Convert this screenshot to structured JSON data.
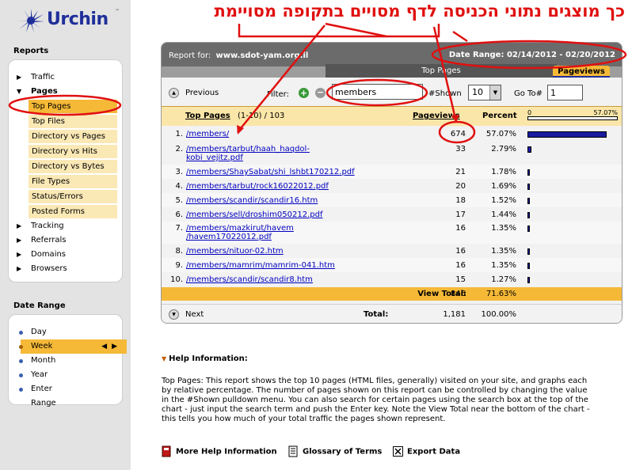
{
  "annotation": {
    "title": "כך מוצגים נתוני הכניסה לדף מסויים בתקופה מסויימת"
  },
  "brand": {
    "name": "Urchin",
    "mark": "™"
  },
  "sidebar": {
    "reports_title": "Reports",
    "items": [
      {
        "label": "Traffic",
        "icon": "triangle-right-icon"
      },
      {
        "label": "Pages",
        "icon": "triangle-down-icon",
        "expanded": true
      },
      {
        "label": "Tracking",
        "icon": "triangle-right-icon"
      },
      {
        "label": "Referrals",
        "icon": "triangle-right-icon"
      },
      {
        "label": "Domains",
        "icon": "triangle-right-icon"
      },
      {
        "label": "Browsers",
        "icon": "triangle-right-icon"
      }
    ],
    "pages_sub": [
      {
        "label": "Top Pages",
        "active": true
      },
      {
        "label": "Top Files"
      },
      {
        "label": "Directory vs Pages"
      },
      {
        "label": "Directory vs Hits"
      },
      {
        "label": "Directory vs Bytes"
      },
      {
        "label": "File Types"
      },
      {
        "label": "Status/Errors"
      },
      {
        "label": "Posted Forms"
      }
    ],
    "date_range_title": "Date Range",
    "date_range": [
      {
        "label": "Day"
      },
      {
        "label": "Week",
        "active": true
      },
      {
        "label": "Month"
      },
      {
        "label": "Year"
      },
      {
        "label": "Enter Range"
      }
    ]
  },
  "report": {
    "report_for_label": "Report for:",
    "site": "www.sdot-yam.org.il",
    "date_range_label": "Date Range: 02/14/2012 - 02/20/2012",
    "tab_title": "Top Pages",
    "tab_metric": "Pageviews",
    "controls": {
      "previous": "Previous",
      "filter_label": "Filter:",
      "filter_value": "members",
      "shown_label": "#Shown",
      "shown_value": "10",
      "goto_label": "Go To#",
      "goto_value": "1",
      "next": "Next"
    },
    "columns": {
      "top_pages": "Top Pages",
      "range": "(1-10) / 103",
      "pageviews": "Pageviews",
      "percent": "Percent",
      "scale_min": "0",
      "scale_max": "57.07%"
    },
    "rows": [
      {
        "num": "1.",
        "page": "/members/",
        "pageviews": "674",
        "percent": "57.07%",
        "share": 57.07
      },
      {
        "num": "2.",
        "page": "/members/tarbut/haah_haqdol-\nkobi_vejitz.pdf",
        "pageviews": "33",
        "percent": "2.79%",
        "share": 2.79
      },
      {
        "num": "3.",
        "page": "/members/ShaySabat/shi_lshbt170212.pdf",
        "pageviews": "21",
        "percent": "1.78%",
        "share": 1.78
      },
      {
        "num": "4.",
        "page": "/members/tarbut/rock16022012.pdf",
        "pageviews": "20",
        "percent": "1.69%",
        "share": 1.69
      },
      {
        "num": "5.",
        "page": "/members/scandir/scandir16.htm",
        "pageviews": "18",
        "percent": "1.52%",
        "share": 1.52
      },
      {
        "num": "6.",
        "page": "/members/sell/droshim050212.pdf",
        "pageviews": "17",
        "percent": "1.44%",
        "share": 1.44
      },
      {
        "num": "7.",
        "page": "/members/mazkirut/havem\n/havem17022012.pdf",
        "pageviews": "16",
        "percent": "1.35%",
        "share": 1.35
      },
      {
        "num": "8.",
        "page": "/members/nituor-02.htm",
        "pageviews": "16",
        "percent": "1.35%",
        "share": 1.35
      },
      {
        "num": "9.",
        "page": "/members/mamrim/mamrim-041.htm",
        "pageviews": "16",
        "percent": "1.35%",
        "share": 1.35
      },
      {
        "num": "10.",
        "page": "/members/scandir/scandir8.htm",
        "pageviews": "15",
        "percent": "1.27%",
        "share": 1.27
      }
    ],
    "view_total": {
      "label": "View Total:",
      "pageviews": "846",
      "percent": "71.63%"
    },
    "total": {
      "label": "Total:",
      "pageviews": "1,181",
      "percent": "100.00%"
    }
  },
  "help": {
    "title": "Help Information:",
    "text": "Top Pages: This report shows the top 10 pages (HTML files, generally) visited on your site, and graphs each by relative percentage. The number of pages shown on this report can be controlled by changing the value in the #Shown pulldown menu. You can also search for certain pages using the search box at the top of the chart - just input the search term and push the Enter key. Note the View Total near the bottom of the chart - this tells you how much of your total traffic the pages shown represent.",
    "links": [
      {
        "label": "More Help Information",
        "icon": "help-book-icon"
      },
      {
        "label": "Glossary of Terms",
        "icon": "glossary-book-icon"
      },
      {
        "label": "Export Data",
        "icon": "export-x-icon"
      }
    ]
  },
  "colors": {
    "accent": "#f5b937",
    "accent_light": "#fae8b5",
    "header_gray": "#6b6b6b",
    "link": "#0000c0",
    "bar": "#1a1aa0",
    "annotation": "#e01010"
  }
}
